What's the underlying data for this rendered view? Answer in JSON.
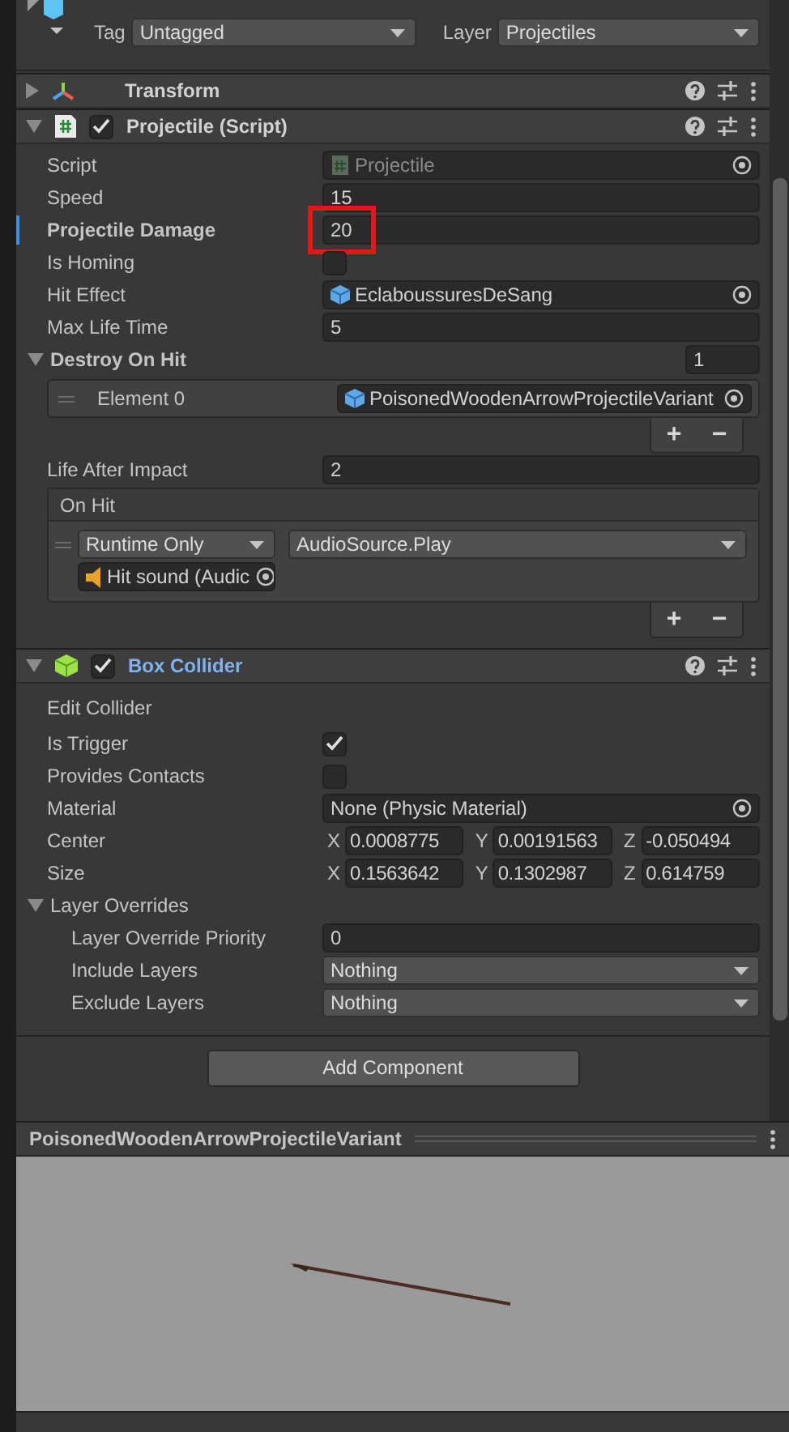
{
  "header": {
    "tag_label": "Tag",
    "tag": "Untagged",
    "layer_label": "Layer",
    "layer": "Projectiles"
  },
  "components": [
    {
      "kind": "transform",
      "title": "Transform",
      "expanded": false,
      "hovered": false
    },
    {
      "kind": "script",
      "title": "Projectile (Script)",
      "expanded": true,
      "enabled": true,
      "hovered": false,
      "fields": [
        {
          "kind": "object",
          "label": "Script",
          "value": "Projectile",
          "asset": {
            "kind": "script"
          },
          "disabled": true
        },
        {
          "kind": "text",
          "label": "Speed",
          "value": "15"
        },
        {
          "kind": "text",
          "label": "Projectile Damage",
          "value": "20",
          "overridden": true,
          "highlighted": true
        },
        {
          "kind": "checkbox",
          "label": "Is Homing",
          "checked": false
        },
        {
          "kind": "object",
          "label": "Hit Effect",
          "value": "EclaboussuresDeSang",
          "asset": {
            "kind": "prefab"
          },
          "disabled": false
        },
        {
          "kind": "text",
          "label": "Max Life Time",
          "value": "5"
        },
        {
          "kind": "list",
          "label": "Destroy On Hit",
          "expanded": true,
          "size": "1",
          "items": [
            {
              "label": "Element 0",
              "value": "PoisonedWoodenArrowProjectileVariant",
              "asset": {
                "kind": "prefab"
              }
            }
          ],
          "add": "+",
          "remove": "−"
        },
        {
          "kind": "text",
          "label": "Life After Impact",
          "value": "2"
        },
        {
          "kind": "event",
          "label": "On Hit",
          "listeners": [
            {
              "mode": "Runtime Only",
              "function": "AudioSource.Play",
              "target": "Hit sound (Audic",
              "asset": {
                "kind": "audio"
              }
            }
          ],
          "add": "+",
          "remove": "−"
        }
      ]
    },
    {
      "kind": "box_collider",
      "title": "Box Collider",
      "expanded": true,
      "enabled": true,
      "hovered": true,
      "fields": [
        {
          "kind": "label",
          "label": "Edit Collider"
        },
        {
          "kind": "checkbox",
          "label": "Is Trigger",
          "checked": true
        },
        {
          "kind": "checkbox",
          "label": "Provides Contacts",
          "checked": false
        },
        {
          "kind": "object",
          "label": "Material",
          "value": "None (Physic Material)",
          "disabled": false
        },
        {
          "kind": "vector",
          "label": "Center",
          "components": [
            {
              "axis": "X",
              "value": "0.0008775"
            },
            {
              "axis": "Y",
              "value": "0.00191563"
            },
            {
              "axis": "Z",
              "value": "-0.050494"
            }
          ]
        },
        {
          "kind": "vector",
          "label": "Size",
          "components": [
            {
              "axis": "X",
              "value": "0.1563642"
            },
            {
              "axis": "Y",
              "value": "0.1302987"
            },
            {
              "axis": "Z",
              "value": "0.614759"
            }
          ]
        },
        {
          "kind": "foldout",
          "label": "Layer Overrides",
          "expanded": true,
          "children": [
            {
              "kind": "text",
              "label": "Layer Override Priority",
              "value": "0"
            },
            {
              "kind": "dropdown",
              "label": "Include Layers",
              "value": "Nothing"
            },
            {
              "kind": "dropdown",
              "label": "Exclude Layers",
              "value": "Nothing"
            }
          ]
        }
      ]
    }
  ],
  "add_component": "Add Component",
  "preview": {
    "title": "PoisonedWoodenArrowProjectileVariant"
  }
}
